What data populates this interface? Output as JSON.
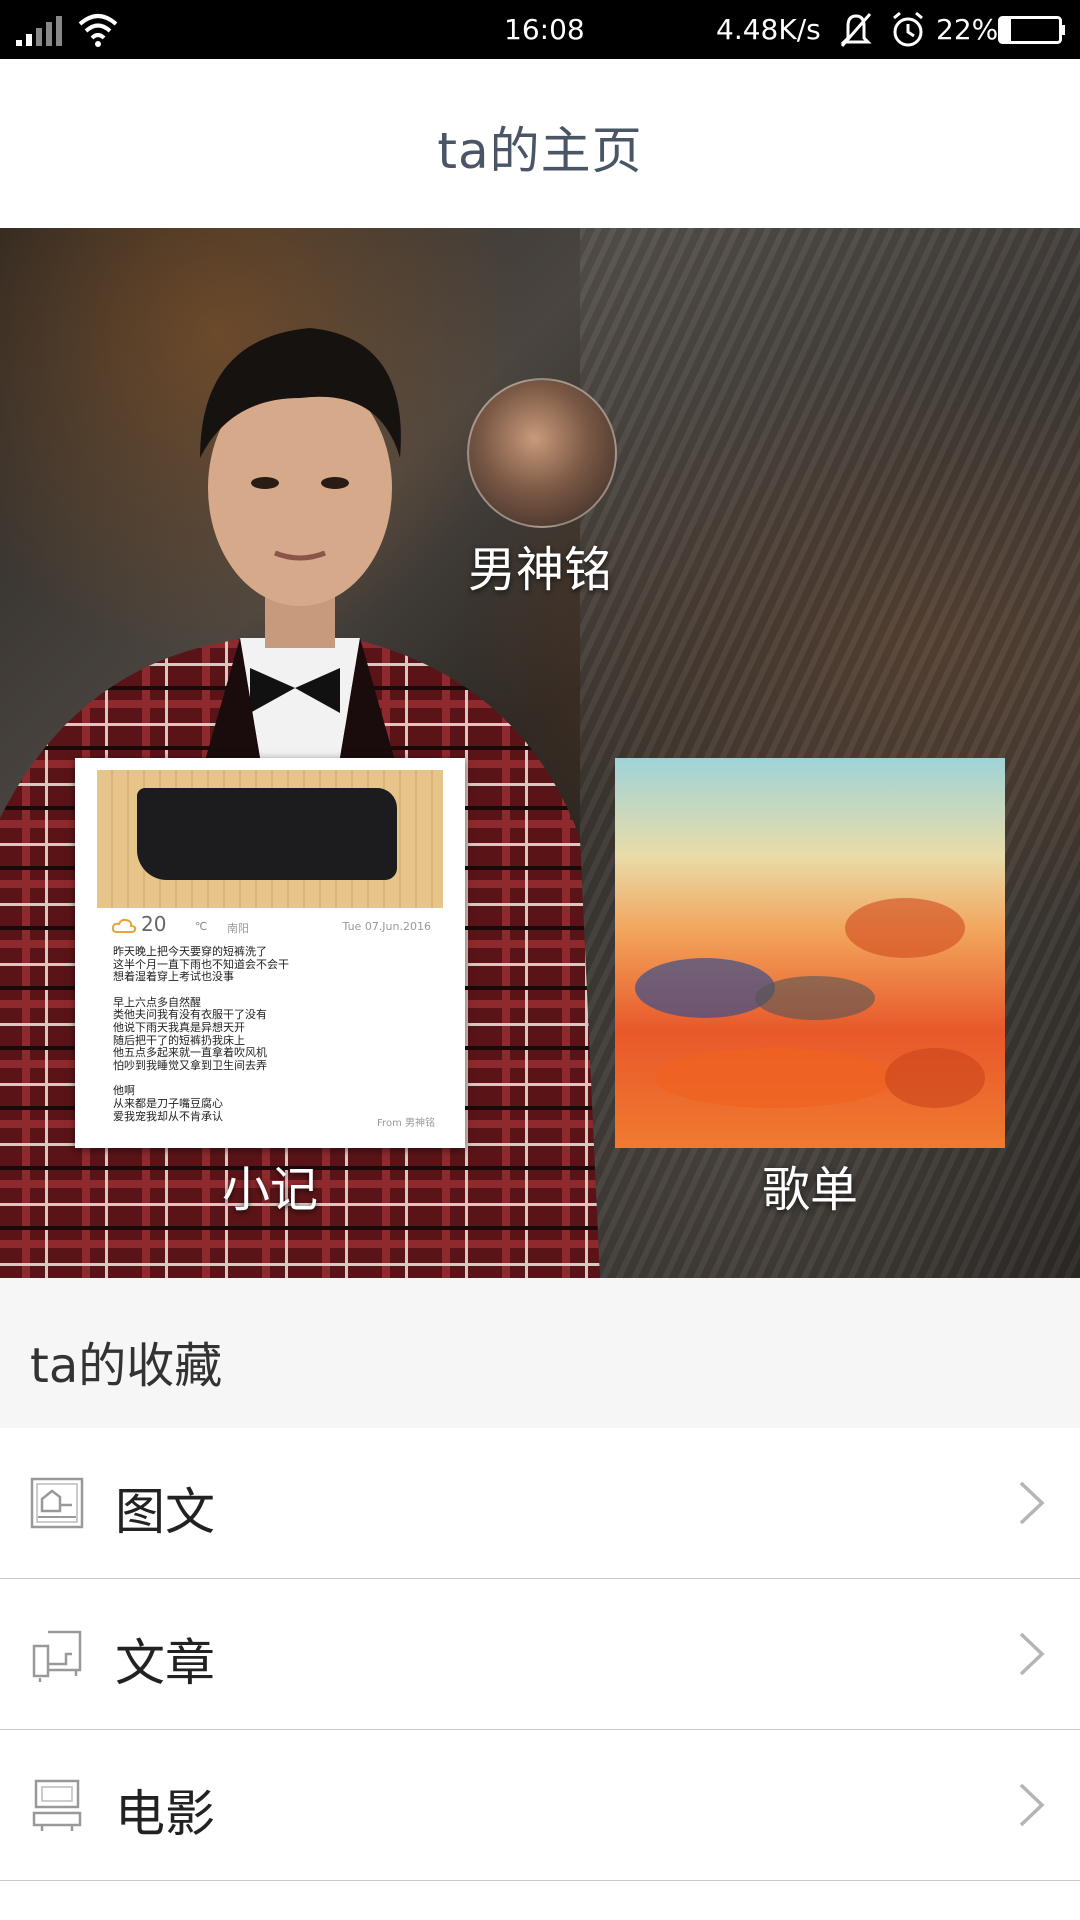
{
  "status_bar": {
    "time": "16:08",
    "network_speed": "4.48K/s",
    "battery": "22%",
    "icons": [
      "signal-icon",
      "wifi-icon",
      "mute-icon",
      "alarm-icon",
      "battery-icon"
    ]
  },
  "header": {
    "title": "ta的主页"
  },
  "profile": {
    "name": "男神铭"
  },
  "cards": {
    "note_label": "小记",
    "songlist_label": "歌单"
  },
  "note_card": {
    "temperature": "20",
    "temperature_unit": "℃",
    "city": "南阳",
    "date": "Tue 07.Jun.2016",
    "paragraphs": [
      [
        "昨天晚上把今天要穿的短裤洗了",
        "这半个月一直下雨也不知道会不会干",
        "想着湿着穿上考试也没事"
      ],
      [
        "早上六点多自然醒",
        "类他夫问我有没有衣服干了没有",
        "他说下雨天我真是异想天开",
        "随后把干了的短裤扔我床上",
        "他五点多起来就一直拿着吹风机",
        "怕吵到我睡觉又拿到卫生间去弄"
      ],
      [
        "他啊",
        "从来都是刀子嘴豆腐心",
        "爱我宠我却从不肯承认"
      ]
    ],
    "signature": "From 男神铭"
  },
  "favorites": {
    "title": "ta的收藏",
    "items": [
      {
        "label": "图文",
        "icon": "image-text-icon"
      },
      {
        "label": "文章",
        "icon": "article-icon"
      },
      {
        "label": "电影",
        "icon": "movie-icon"
      }
    ],
    "chevron_icon": "chevron-right-icon"
  },
  "colors": {
    "header_title": "#4a5566",
    "status_bar_bg": "#000000",
    "section_bg": "#f6f6f6",
    "divider": "#c9c9c9"
  }
}
